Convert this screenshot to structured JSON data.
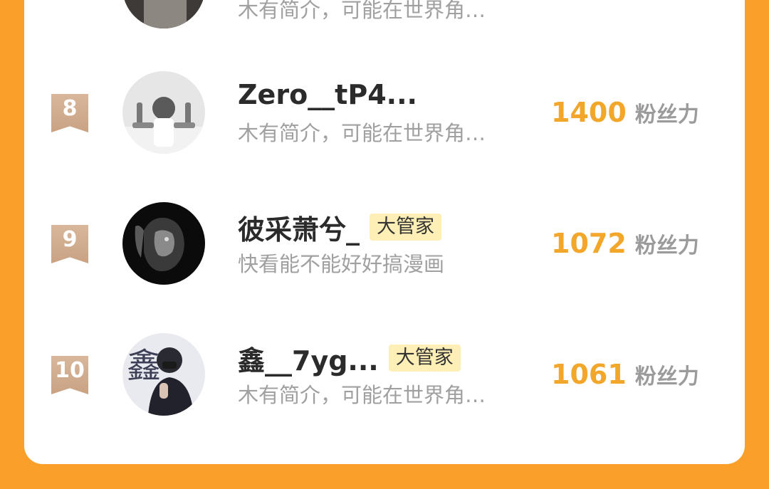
{
  "rows": [
    {
      "rank": "",
      "name": "",
      "badge": "",
      "bio": "木有简介，可能在世界角…",
      "score": "",
      "unit": "",
      "avatar_icon": "avatar-photo"
    },
    {
      "rank": "8",
      "name": "Zero__tP4...",
      "badge": "",
      "bio": "木有简介，可能在世界角…",
      "score": "1400",
      "unit": "粉丝力",
      "avatar_icon": "avatar-keep-dreaming"
    },
    {
      "rank": "9",
      "name": "彼采萧兮_",
      "badge": "大管家",
      "bio": "快看能不能好好搞漫画",
      "score": "1072",
      "unit": "粉丝力",
      "avatar_icon": "avatar-lion"
    },
    {
      "rank": "10",
      "name": "鑫__7yg...",
      "badge": "大管家",
      "bio": "木有简介，可能在世界角…",
      "score": "1061",
      "unit": "粉丝力",
      "avatar_icon": "avatar-person"
    }
  ],
  "colors": {
    "background": "#f99f2a",
    "score": "#f2a62a",
    "rank_ribbon": "#c9a283",
    "badge_bg": "#fdefb5"
  }
}
